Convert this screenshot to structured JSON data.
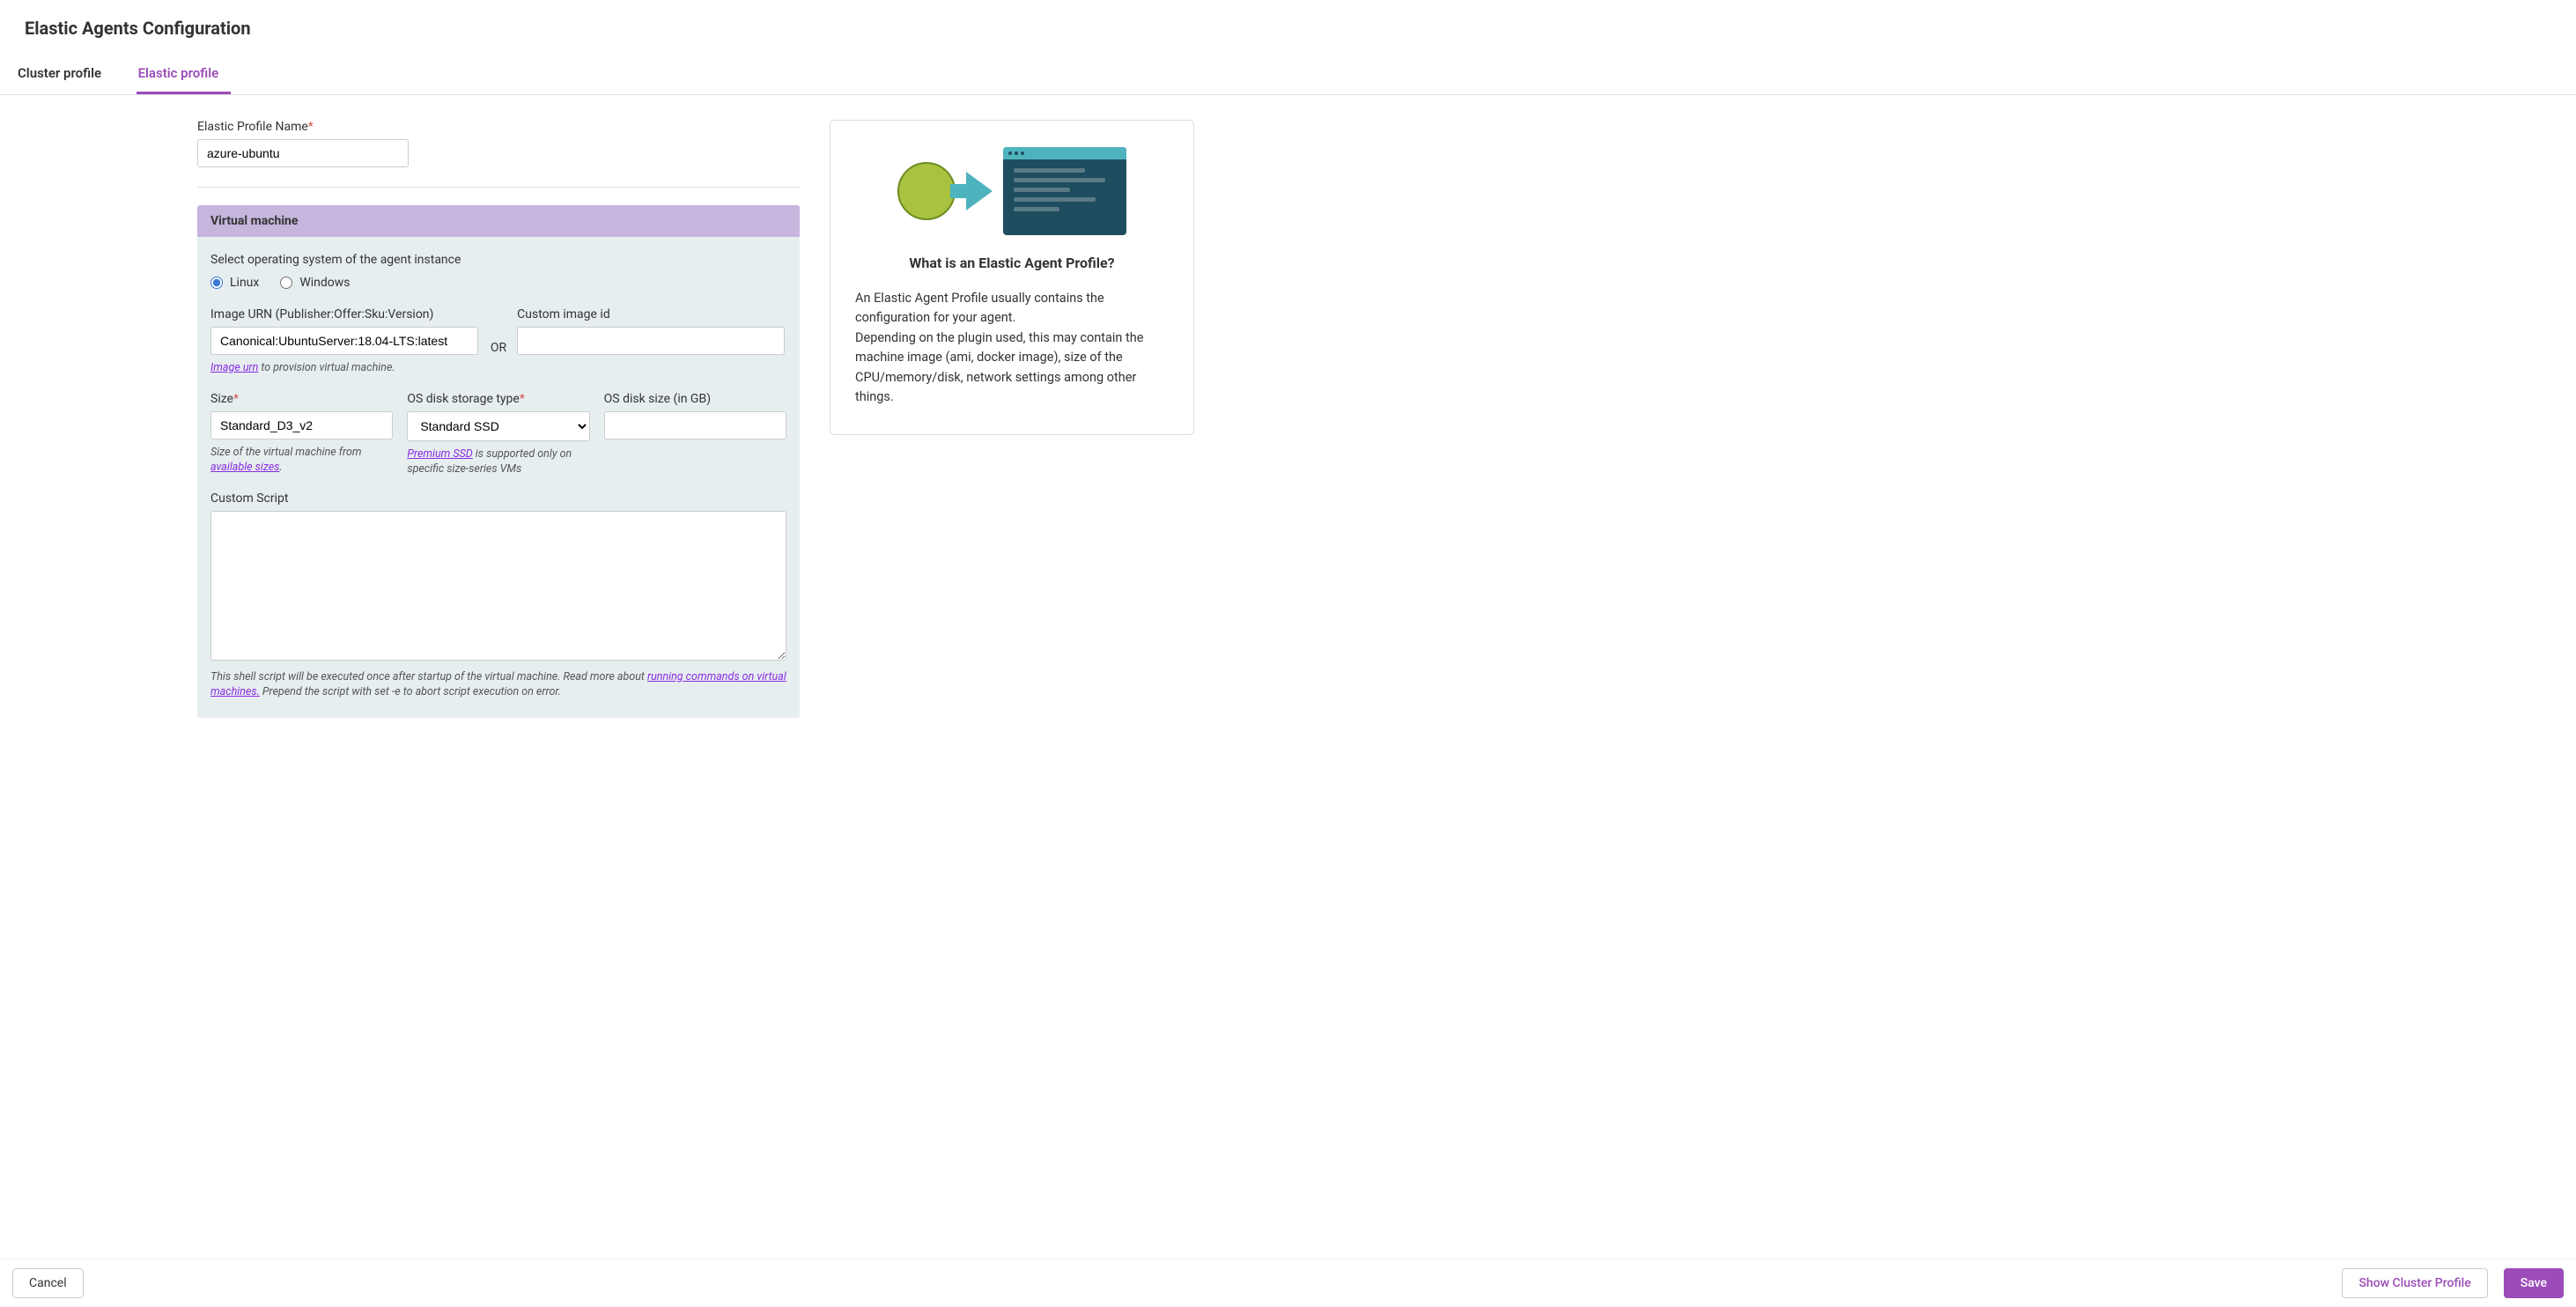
{
  "header": {
    "title": "Elastic Agents Configuration"
  },
  "tabs": {
    "cluster": "Cluster profile",
    "elastic": "Elastic profile"
  },
  "form": {
    "profile_name_label": "Elastic Profile Name",
    "profile_name_value": "azure-ubuntu",
    "vm_section_title": "Virtual machine",
    "os_select_label": "Select operating system of the agent instance",
    "os_linux": "Linux",
    "os_windows": "Windows",
    "image_urn_label": "Image URN (Publisher:Offer:Sku:Version)",
    "image_urn_value": "Canonical:UbuntuServer:18.04-LTS:latest",
    "image_urn_help_link": "Image urn",
    "image_urn_help_text": " to provision virtual machine.",
    "custom_image_label": "Custom image id",
    "custom_image_value": "",
    "or_text": "OR",
    "size_label": "Size",
    "size_value": "Standard_D3_v2",
    "size_help_prefix": "Size of the virtual machine from ",
    "size_help_link": "available sizes",
    "size_help_suffix": ".",
    "disk_type_label": "OS disk storage type",
    "disk_type_value": "Standard SSD",
    "disk_type_help_link": "Premium SSD",
    "disk_type_help_text": " is supported only on specific size-series VMs",
    "disk_size_label": "OS disk size (in GB)",
    "disk_size_value": "",
    "custom_script_label": "Custom Script",
    "custom_script_value": "",
    "script_help_prefix": "This shell script will be executed once after startup of the virtual machine. Read more about ",
    "script_help_link": "running commands on virtual machines.",
    "script_help_suffix": " Prepend the script with set -e to abort script execution on error."
  },
  "info": {
    "title": "What is an Elastic Agent Profile?",
    "para1": "An Elastic Agent Profile usually contains the configuration for your agent.",
    "para2": "Depending on the plugin used, this may contain the machine image (ami, docker image), size of the CPU/memory/disk, network settings among other things."
  },
  "footer": {
    "cancel": "Cancel",
    "show_cluster": "Show Cluster Profile",
    "save": "Save"
  }
}
